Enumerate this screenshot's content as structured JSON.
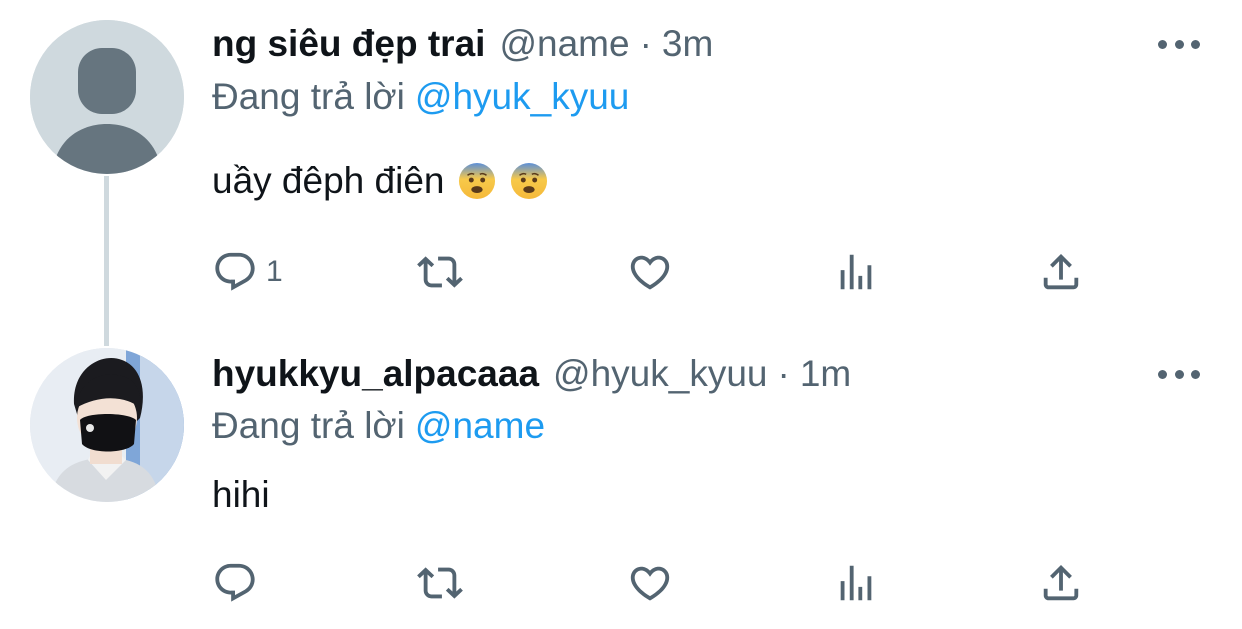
{
  "tweets": [
    {
      "display_name": "ng siêu đẹp trai",
      "handle": "@name",
      "separator": "·",
      "time": "3m",
      "replying_label": "Đang trả lời",
      "replying_to": "@hyuk_kyuu",
      "text": "uầy đêph điên",
      "emojis": [
        "fearful-face-emoji",
        "fearful-face-emoji"
      ],
      "reply_count": "1"
    },
    {
      "display_name": "hyukkyu_alpacaaa",
      "handle": "@hyuk_kyuu",
      "separator": "·",
      "time": "1m",
      "replying_label": "Đang trả lời",
      "replying_to": "@name",
      "text": "hihi",
      "reply_count": ""
    }
  ],
  "icons": {
    "reply": "reply-icon",
    "retweet": "retweet-icon",
    "like": "heart-icon",
    "views": "views-icon",
    "share": "share-icon",
    "more": "more-icon"
  },
  "colors": {
    "text": "#0f1419",
    "secondary": "#536471",
    "accent": "#1d9bf0",
    "thread_line": "#cfd9de"
  }
}
